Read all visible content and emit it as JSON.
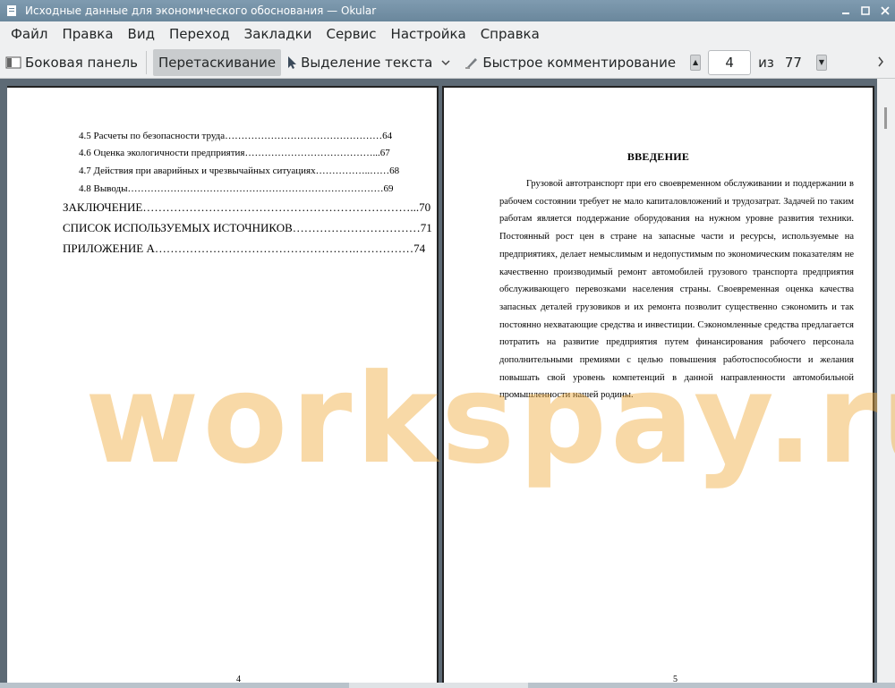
{
  "window": {
    "title": "Исходные данные для экономического обоснования  — Okular"
  },
  "menu": [
    "Файл",
    "Правка",
    "Вид",
    "Переход",
    "Закладки",
    "Сервис",
    "Настройка",
    "Справка"
  ],
  "toolbar": {
    "sidebar_label": "Боковая панель",
    "drag_label": "Перетаскивание",
    "select_label": "Выделение текста",
    "annotate_label": "Быстрое комментирование",
    "page_current": "4",
    "page_of": "из",
    "page_total": "77"
  },
  "left_page": {
    "toc": [
      {
        "text": "4.5 Расчеты по безопасности труда…………………………………………64"
      },
      {
        "text": "4.6 Оценка экологичности предприятия…………………………………...67"
      },
      {
        "text": "4.7 Действия при аварийных и чрезвычайных ситуациях……………..……68"
      },
      {
        "text": "4.8 Выводы……………………………………………………………………69"
      },
      {
        "text": "ЗАКЛЮЧЕНИЕ……………………………………………………………...70"
      },
      {
        "text": "СПИСОК ИСПОЛЬЗУЕМЫХ ИСТОЧНИКОВ……………………………71"
      },
      {
        "text": "ПРИЛОЖЕНИЕ А…………………………………………….……………74"
      }
    ],
    "page_number": "4"
  },
  "right_page": {
    "heading": "ВВЕДЕНИЕ",
    "paragraph": "Грузовой автотранспорт при его своевременном обслуживании и поддержании в рабочем состоянии требует не мало капиталовложений и трудозатрат. Задачей по таким работам является поддержание оборудования на нужном уровне развития техники. Постоянный рост цен в стране на запасные части и ресурсы, используемые на предприятиях, делает немыслимым и недопустимым по экономическим показателям не качественно производимый ремонт автомобилей грузового транспорта предприятия обслуживающего перевозками населения страны. Своевременная оценка качества запасных деталей грузовиков и их ремонта позволит существенно сэкономить и так постоянно нехватающие средства и  инвестиции. Сэкономленные средства предлагается потратить на развитие предприятия путем финансирования рабочего персонала дополнительными премиями с целью повышения работоспособности и желания повышать свой уровень компетенций в данной направленности автомобильной промышленности нашей родины.",
    "page_number": "5"
  },
  "watermark": "workspay.ru"
}
